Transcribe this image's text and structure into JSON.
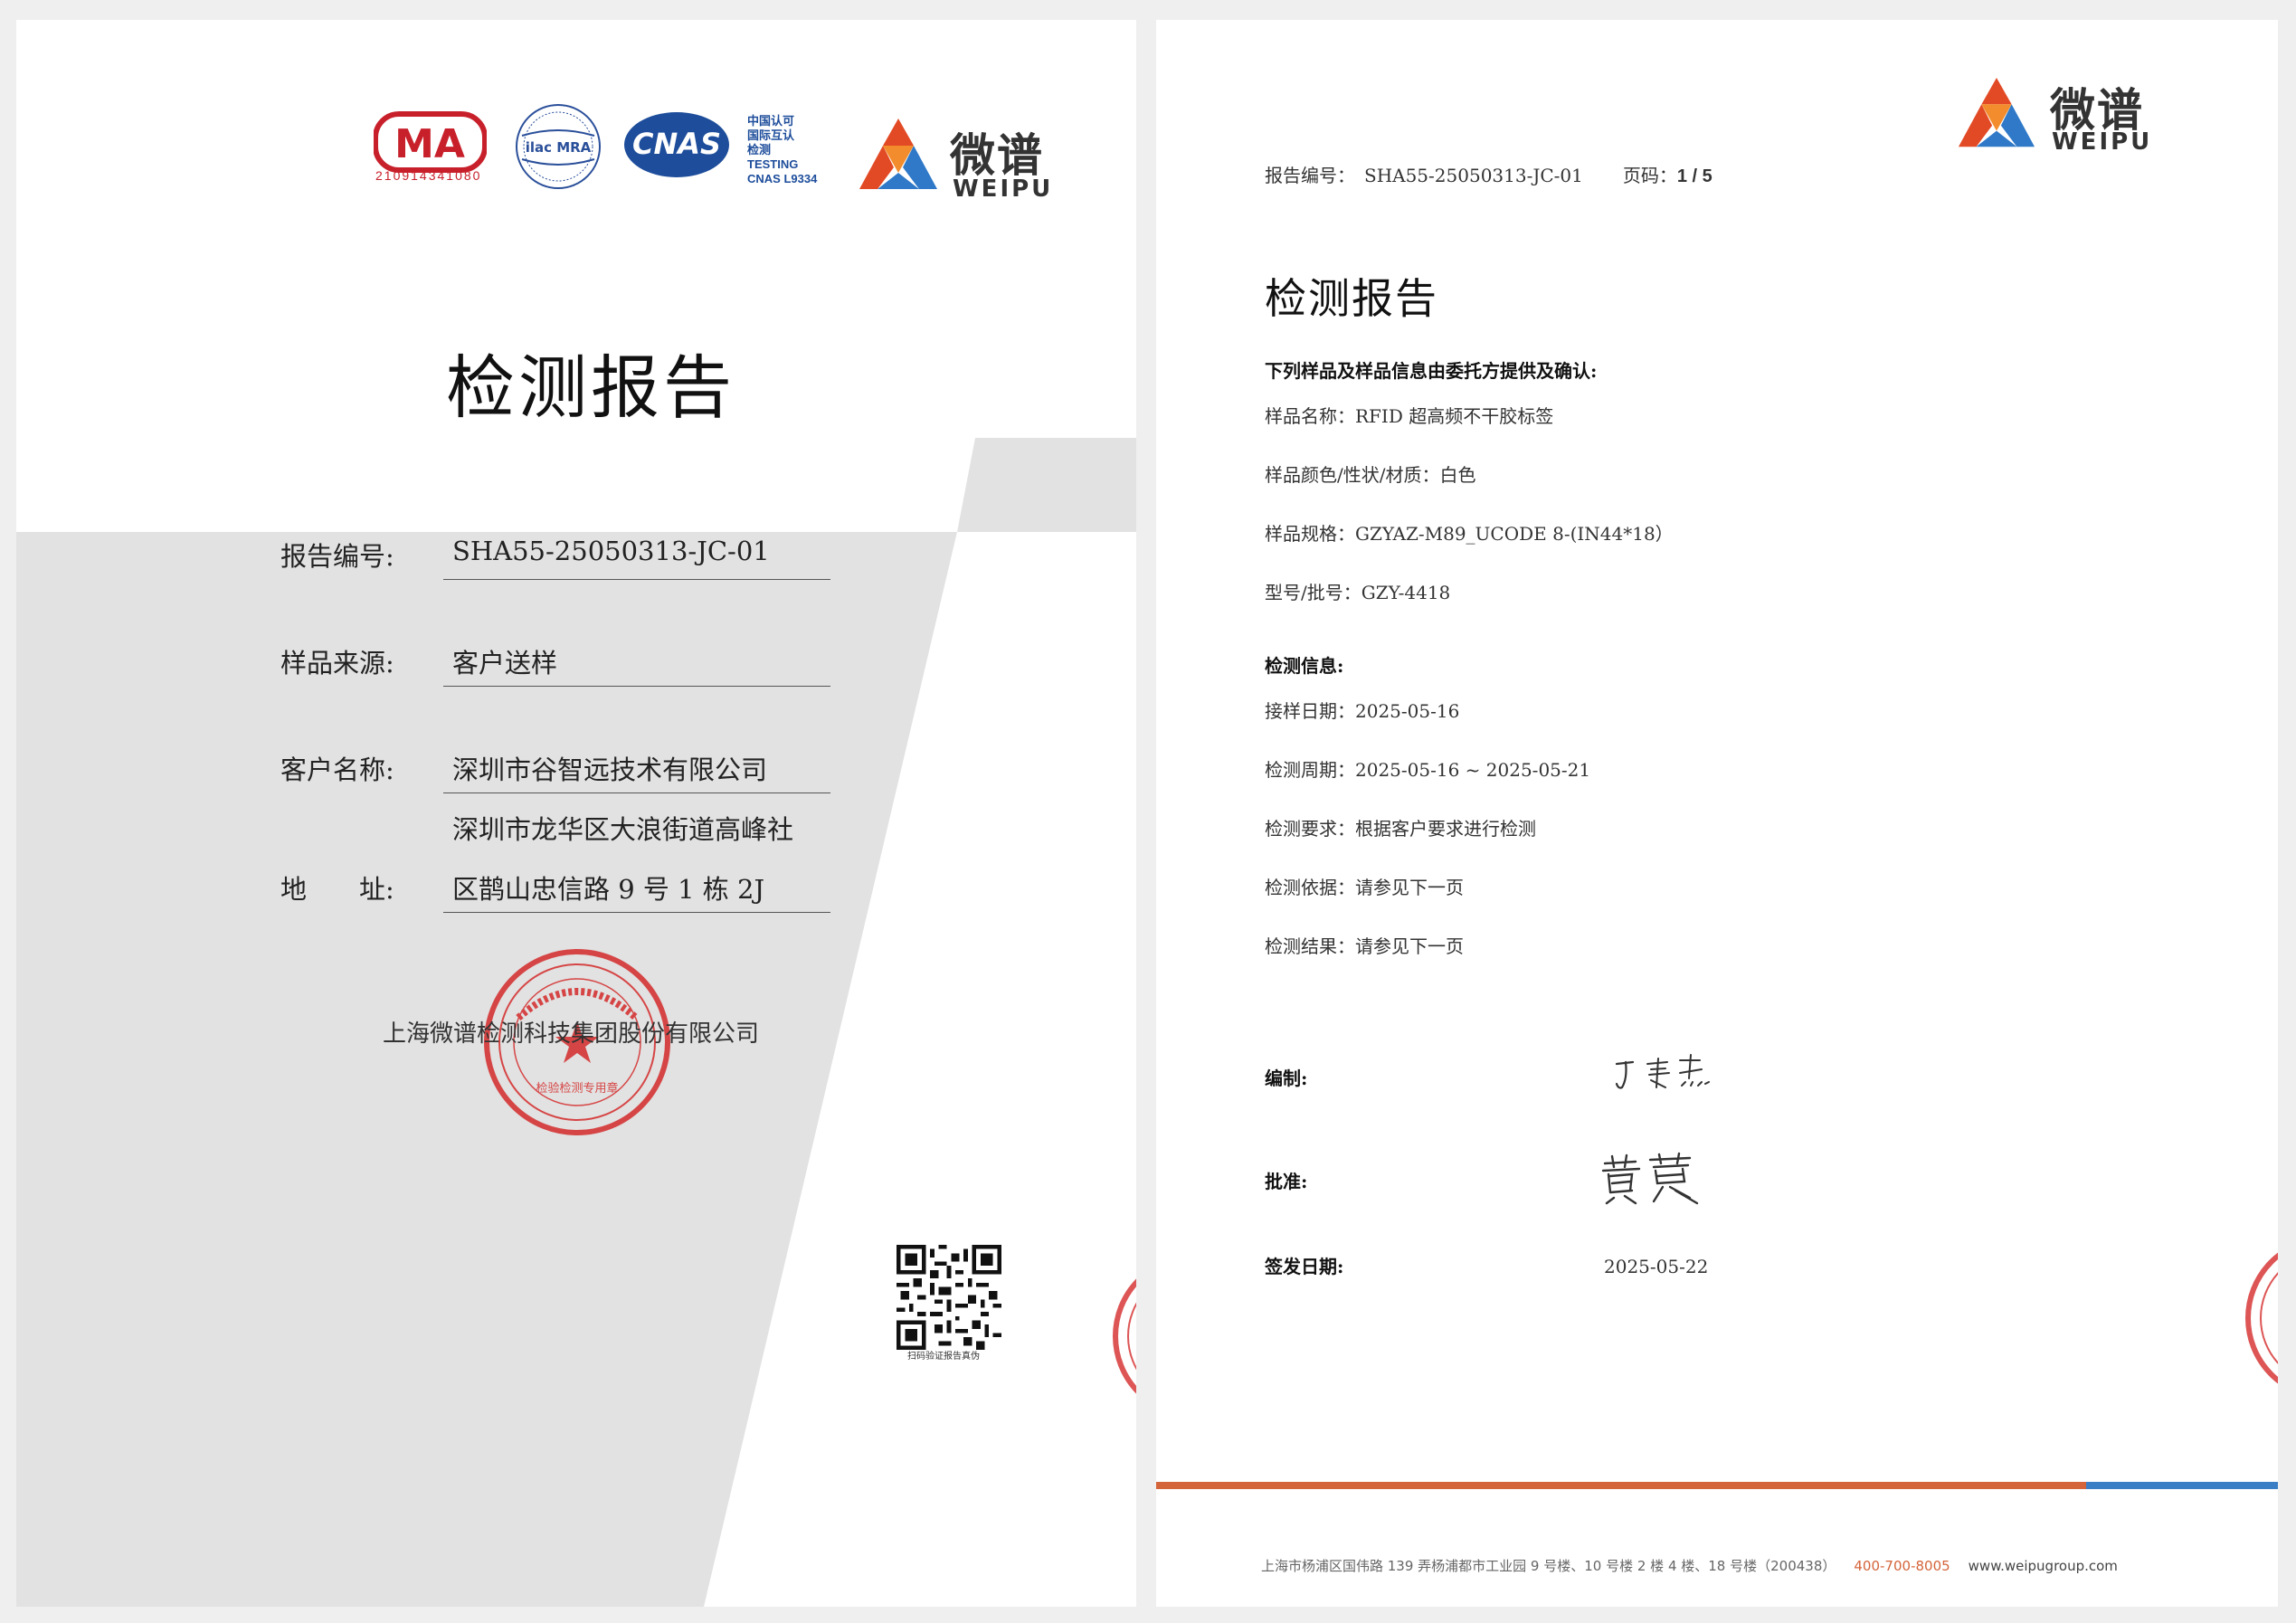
{
  "cover": {
    "cma_number": "210914341080",
    "ilac_text": "ilac MRA",
    "cnas_text": "CNAS",
    "cnas_cn_lines": [
      "中国认可",
      "国际互认",
      "检测",
      "TESTING",
      "CNAS L9334"
    ],
    "brand_cn": "微谱",
    "brand_en": "WEIPU",
    "title": "检测报告",
    "report_no_label": "报告编号:",
    "report_no": "SHA55-25050313-JC-01",
    "sample_source_label": "样品来源:",
    "sample_source": "客户送样",
    "client_name_label": "客户名称:",
    "client_name": "深圳市谷智远技术有限公司",
    "address_label": "地　　址:",
    "address_line1": "深圳市龙华区大浪街道高峰社",
    "address_line2": "区鹊山忠信路 9 号 1 栋 2J",
    "company": "上海微谱检测科技集团股份有限公司",
    "seal_text": "SHANGHAI WEIPU TESTING TECHNOLOGY GROUP CO.,LTD. INSPECTION TESTING SERVICE",
    "seal_sub": "检验检测专用章",
    "qr_caption": "扫码验证报告真伪"
  },
  "detail": {
    "brand_cn": "微谱",
    "brand_en": "WEIPU",
    "report_no_label": "报告编号：",
    "report_no": "SHA55-25050313-JC-01",
    "page_label": "页码：",
    "page_value": "1 / 5",
    "title": "检测报告",
    "sample_heading": "下列样品及样品信息由委托方提供及确认:",
    "sample_name": "样品名称：RFID 超高频不干胶标签",
    "sample_color": "样品颜色/性状/材质：白色",
    "sample_spec": "样品规格：GZYAZ-M89_UCODE 8-(IN44*18）",
    "sample_model": "型号/批号：GZY-4418",
    "test_heading": "检测信息:",
    "receive_date": "接样日期：2025-05-16",
    "test_period": "检测周期：2025-05-16 ~ 2025-05-21",
    "test_requirement": "检测要求：根据客户要求进行检测",
    "test_basis": "检测依据：请参见下一页",
    "test_result": "检测结果：请参见下一页",
    "compiled_label": "编制:",
    "approved_label": "批准:",
    "issue_date_label": "签发日期:",
    "issue_date": "2025-05-22",
    "footer_address": "上海市杨浦区国伟路 139 弄杨浦都市工业园 9 号楼、10 号楼 2 楼 4 楼、18 号楼（200438）",
    "footer_phone": "400-700-8005",
    "footer_web": "www.weipugroup.com"
  },
  "colors": {
    "seal_red": "#d42a2a",
    "accent_orange": "#d4643a",
    "accent_blue": "#3a7ec5",
    "band_gray": "#e2e2e2"
  }
}
